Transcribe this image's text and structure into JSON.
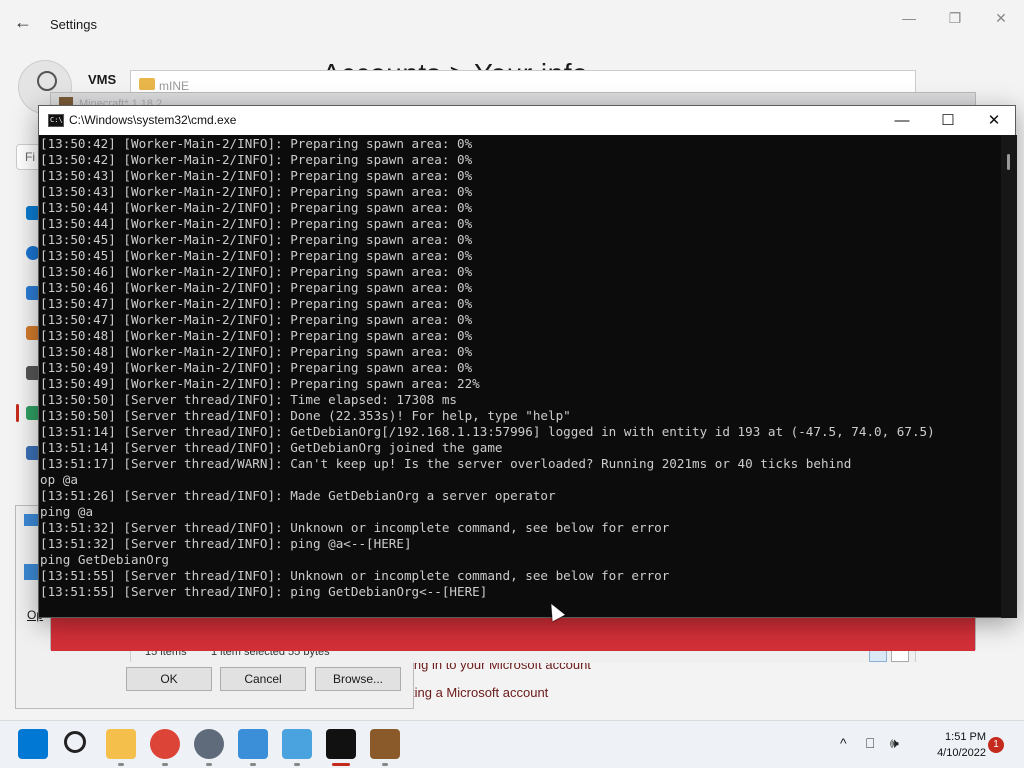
{
  "settings": {
    "title": "Settings",
    "back": "←",
    "minimize": "—",
    "restore": "❐",
    "close": "✕",
    "username": "VMS",
    "heading": "Accounts  >  Your info",
    "find_placeholder": "Fi",
    "link1": "ing in to your Microsoft account",
    "link2": "ting a Microsoft account"
  },
  "open_dialog": {
    "label_abbr": "Op",
    "ok": "OK",
    "cancel": "Cancel",
    "browse": "Browse..."
  },
  "mine_window": {
    "title": "mINE",
    "items_count": "15 items",
    "selection": "1 item selected  55 bytes"
  },
  "minecraft_window": {
    "title": "Minecraft* 1.18.2"
  },
  "cmd": {
    "title": "C:\\Windows\\system32\\cmd.exe",
    "icon_text": "C:\\",
    "minimize": "—",
    "maximize": "☐",
    "close": "✕",
    "lines": [
      "[13:50:42] [Worker-Main-2/INFO]: Preparing spawn area: 0%",
      "[13:50:42] [Worker-Main-2/INFO]: Preparing spawn area: 0%",
      "[13:50:43] [Worker-Main-2/INFO]: Preparing spawn area: 0%",
      "[13:50:43] [Worker-Main-2/INFO]: Preparing spawn area: 0%",
      "[13:50:44] [Worker-Main-2/INFO]: Preparing spawn area: 0%",
      "[13:50:44] [Worker-Main-2/INFO]: Preparing spawn area: 0%",
      "[13:50:45] [Worker-Main-2/INFO]: Preparing spawn area: 0%",
      "[13:50:45] [Worker-Main-2/INFO]: Preparing spawn area: 0%",
      "[13:50:46] [Worker-Main-2/INFO]: Preparing spawn area: 0%",
      "[13:50:46] [Worker-Main-2/INFO]: Preparing spawn area: 0%",
      "[13:50:47] [Worker-Main-2/INFO]: Preparing spawn area: 0%",
      "[13:50:47] [Worker-Main-2/INFO]: Preparing spawn area: 0%",
      "[13:50:48] [Worker-Main-2/INFO]: Preparing spawn area: 0%",
      "[13:50:48] [Worker-Main-2/INFO]: Preparing spawn area: 0%",
      "[13:50:49] [Worker-Main-2/INFO]: Preparing spawn area: 0%",
      "[13:50:49] [Worker-Main-2/INFO]: Preparing spawn area: 22%",
      "[13:50:50] [Server thread/INFO]: Time elapsed: 17308 ms",
      "[13:50:50] [Server thread/INFO]: Done (22.353s)! For help, type \"help\"",
      "[13:51:14] [Server thread/INFO]: GetDebianOrg[/192.168.1.13:57996] logged in with entity id 193 at (-47.5, 74.0, 67.5)",
      "[13:51:14] [Server thread/INFO]: GetDebianOrg joined the game",
      "[13:51:17] [Server thread/WARN]: Can't keep up! Is the server overloaded? Running 2021ms or 40 ticks behind",
      "op @a",
      "[13:51:26] [Server thread/INFO]: Made GetDebianOrg a server operator",
      "ping @a",
      "[13:51:32] [Server thread/INFO]: Unknown or incomplete command, see below for error",
      "[13:51:32] [Server thread/INFO]: ping @a<--[HERE]",
      "ping GetDebianOrg",
      "[13:51:55] [Server thread/INFO]: Unknown or incomplete command, see below for error",
      "[13:51:55] [Server thread/INFO]: ping GetDebianOrg<--[HERE]"
    ]
  },
  "taskbar": {
    "apps": [
      {
        "name": "start-icon",
        "color": "#0078d4"
      },
      {
        "name": "search-icon",
        "color": "#222222"
      },
      {
        "name": "file-explorer-icon",
        "color": "#f4c04b"
      },
      {
        "name": "chrome-icon",
        "color": "#db4437"
      },
      {
        "name": "settings-icon",
        "color": "#5f6b7a"
      },
      {
        "name": "notepad-icon",
        "color": "#3b8ed8"
      },
      {
        "name": "remote-desktop-icon",
        "color": "#4aa3df"
      },
      {
        "name": "cmd-icon",
        "color": "#111111"
      },
      {
        "name": "minecraft-icon",
        "color": "#8b5a2b"
      }
    ],
    "time": "1:51 PM",
    "date": "4/10/2022",
    "notifications": "1",
    "tray_chevron": "^",
    "tray_display": "⎕",
    "tray_volume": "🕪"
  }
}
